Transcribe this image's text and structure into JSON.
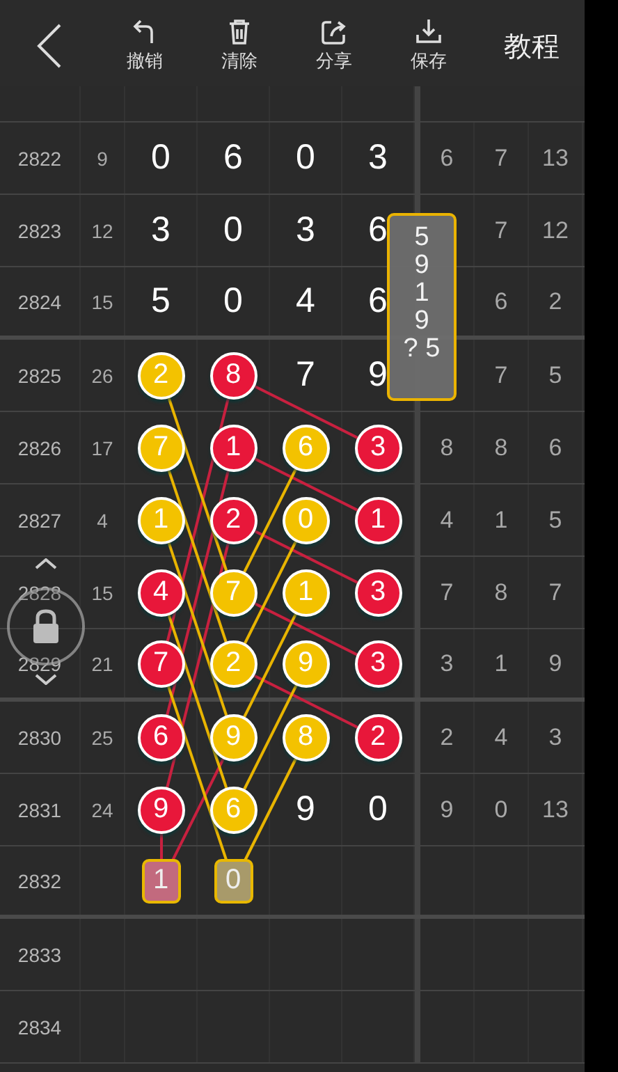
{
  "header": {
    "actions": [
      {
        "kind": "undo",
        "label": "撤销"
      },
      {
        "kind": "clear",
        "label": "清除"
      },
      {
        "kind": "share",
        "label": "分享"
      },
      {
        "kind": "save",
        "label": "保存"
      }
    ],
    "tutorial": "教程"
  },
  "rows": [
    {
      "issue": "2822",
      "sum": "9",
      "digits": [
        {
          "value": "0",
          "kind": "plain"
        },
        {
          "value": "6",
          "kind": "plain"
        },
        {
          "value": "0",
          "kind": "plain"
        },
        {
          "value": "3",
          "kind": "plain"
        }
      ],
      "stats": [
        "6",
        "7",
        "13"
      ]
    },
    {
      "issue": "2823",
      "sum": "12",
      "digits": [
        {
          "value": "3",
          "kind": "plain"
        },
        {
          "value": "0",
          "kind": "plain"
        },
        {
          "value": "3",
          "kind": "plain"
        },
        {
          "value": "6",
          "kind": "plain"
        }
      ],
      "stats": [
        "7",
        "12"
      ]
    },
    {
      "issue": "2824",
      "sum": "15",
      "digits": [
        {
          "value": "5",
          "kind": "plain"
        },
        {
          "value": "0",
          "kind": "plain"
        },
        {
          "value": "4",
          "kind": "plain"
        },
        {
          "value": "6",
          "kind": "plain"
        }
      ],
      "stats": [
        "6",
        "2"
      ]
    },
    {
      "issue": "2825",
      "sum": "26",
      "digits": [
        {
          "value": "2",
          "kind": "yellow"
        },
        {
          "value": "8",
          "kind": "red"
        },
        {
          "value": "7",
          "kind": "plain"
        },
        {
          "value": "9",
          "kind": "plain"
        }
      ],
      "stats": [
        "7",
        "5"
      ]
    },
    {
      "issue": "2826",
      "sum": "17",
      "digits": [
        {
          "value": "7",
          "kind": "yellow"
        },
        {
          "value": "1",
          "kind": "red"
        },
        {
          "value": "6",
          "kind": "yellow"
        },
        {
          "value": "3",
          "kind": "red"
        }
      ],
      "stats": [
        "8",
        "8",
        "6"
      ]
    },
    {
      "issue": "2827",
      "sum": "4",
      "digits": [
        {
          "value": "1",
          "kind": "yellow"
        },
        {
          "value": "2",
          "kind": "red"
        },
        {
          "value": "0",
          "kind": "yellow"
        },
        {
          "value": "1",
          "kind": "red"
        }
      ],
      "stats": [
        "4",
        "1",
        "5"
      ]
    },
    {
      "issue": "2828",
      "sum": "15",
      "digits": [
        {
          "value": "4",
          "kind": "red"
        },
        {
          "value": "7",
          "kind": "yellow"
        },
        {
          "value": "1",
          "kind": "yellow"
        },
        {
          "value": "3",
          "kind": "red"
        }
      ],
      "stats": [
        "7",
        "8",
        "7"
      ]
    },
    {
      "issue": "2829",
      "sum": "21",
      "digits": [
        {
          "value": "7",
          "kind": "red"
        },
        {
          "value": "2",
          "kind": "yellow"
        },
        {
          "value": "9",
          "kind": "yellow"
        },
        {
          "value": "3",
          "kind": "red"
        }
      ],
      "stats": [
        "3",
        "1",
        "9"
      ]
    },
    {
      "issue": "2830",
      "sum": "25",
      "digits": [
        {
          "value": "6",
          "kind": "red"
        },
        {
          "value": "9",
          "kind": "yellow"
        },
        {
          "value": "8",
          "kind": "yellow"
        },
        {
          "value": "2",
          "kind": "red"
        }
      ],
      "stats": [
        "2",
        "4",
        "3"
      ]
    },
    {
      "issue": "2831",
      "sum": "24",
      "digits": [
        {
          "value": "9",
          "kind": "red"
        },
        {
          "value": "6",
          "kind": "yellow"
        },
        {
          "value": "9",
          "kind": "plain"
        },
        {
          "value": "0",
          "kind": "plain"
        }
      ],
      "stats": [
        "9",
        "0",
        "13"
      ]
    },
    {
      "issue": "2832",
      "digits": [
        {
          "value": "1",
          "kind": "red-pending"
        },
        {
          "value": "0",
          "kind": "yellow-pending"
        }
      ]
    },
    {
      "issue": "2833"
    },
    {
      "issue": "2834"
    }
  ],
  "popup": {
    "lines": [
      "5",
      "9",
      "1",
      "9",
      "? 5"
    ]
  }
}
